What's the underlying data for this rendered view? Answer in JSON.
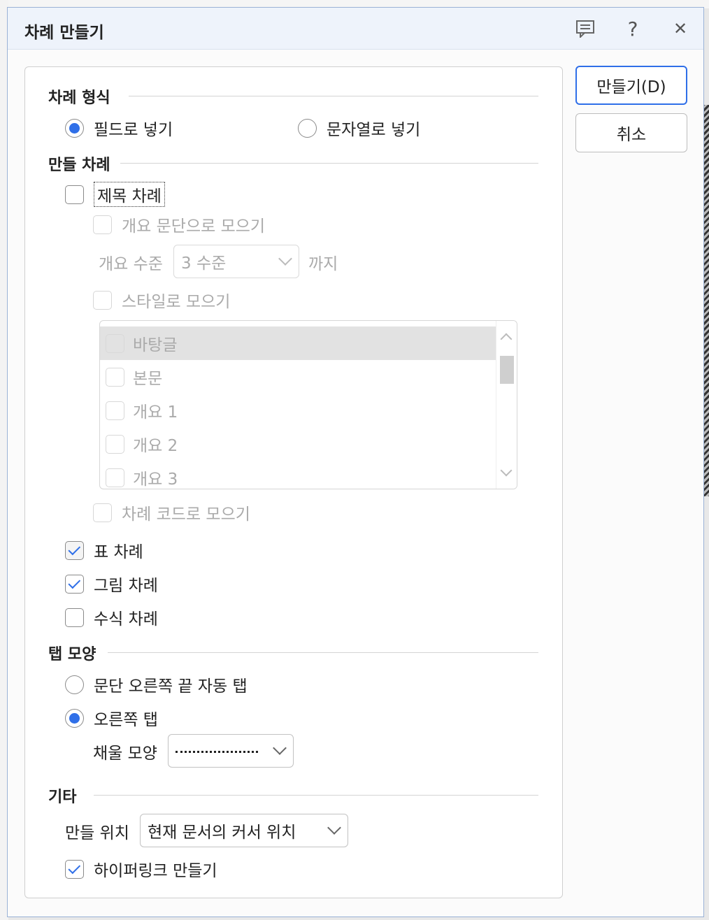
{
  "dialog": {
    "title": "차례 만들기",
    "help_glyph": "?",
    "close_glyph": "✕"
  },
  "buttons": {
    "create_label": "만들기(D)",
    "cancel_label": "취소"
  },
  "toc_format": {
    "heading": "차례 형식",
    "options": [
      {
        "label": "필드로 넣기",
        "selected": true
      },
      {
        "label": "문자열로 넣기",
        "selected": false
      }
    ]
  },
  "toc_create": {
    "heading": "만들 차례",
    "title_toc": {
      "label": "제목 차례",
      "checked": false
    },
    "outline_paragraph": {
      "label": "개요 문단으로 모으기",
      "checked": false,
      "enabled": false
    },
    "outline_level": {
      "label": "개요 수준",
      "value": "3 수준",
      "suffix": "까지",
      "enabled": false
    },
    "style_collect": {
      "label": "스타일로 모으기",
      "checked": false,
      "enabled": false
    },
    "style_list": [
      {
        "label": "바탕글",
        "selected": true
      },
      {
        "label": "본문",
        "selected": false
      },
      {
        "label": "개요 1",
        "selected": false
      },
      {
        "label": "개요 2",
        "selected": false
      },
      {
        "label": "개요 3",
        "selected": false
      }
    ],
    "toc_code": {
      "label": "차례 코드로 모으기",
      "checked": false,
      "enabled": false
    },
    "table_toc": {
      "label": "표 차례",
      "checked": true
    },
    "figure_toc": {
      "label": "그림 차례",
      "checked": true
    },
    "equation_toc": {
      "label": "수식 차례",
      "checked": false
    }
  },
  "tab_shape": {
    "heading": "탭 모양",
    "options": [
      {
        "label": "문단 오른쪽 끝 자동 탭",
        "selected": false
      },
      {
        "label": "오른쪽 탭",
        "selected": true
      }
    ],
    "fill_label": "채울 모양"
  },
  "other": {
    "heading": "기타",
    "position_label": "만들 위치",
    "position_value": "현재 문서의 커서 위치",
    "hyperlink": {
      "label": "하이퍼링크 만들기",
      "checked": true
    }
  },
  "colors": {
    "accent": "#2f6fe8",
    "titlebar": "#eef3fb",
    "disabled_text": "#aaaaaa"
  }
}
